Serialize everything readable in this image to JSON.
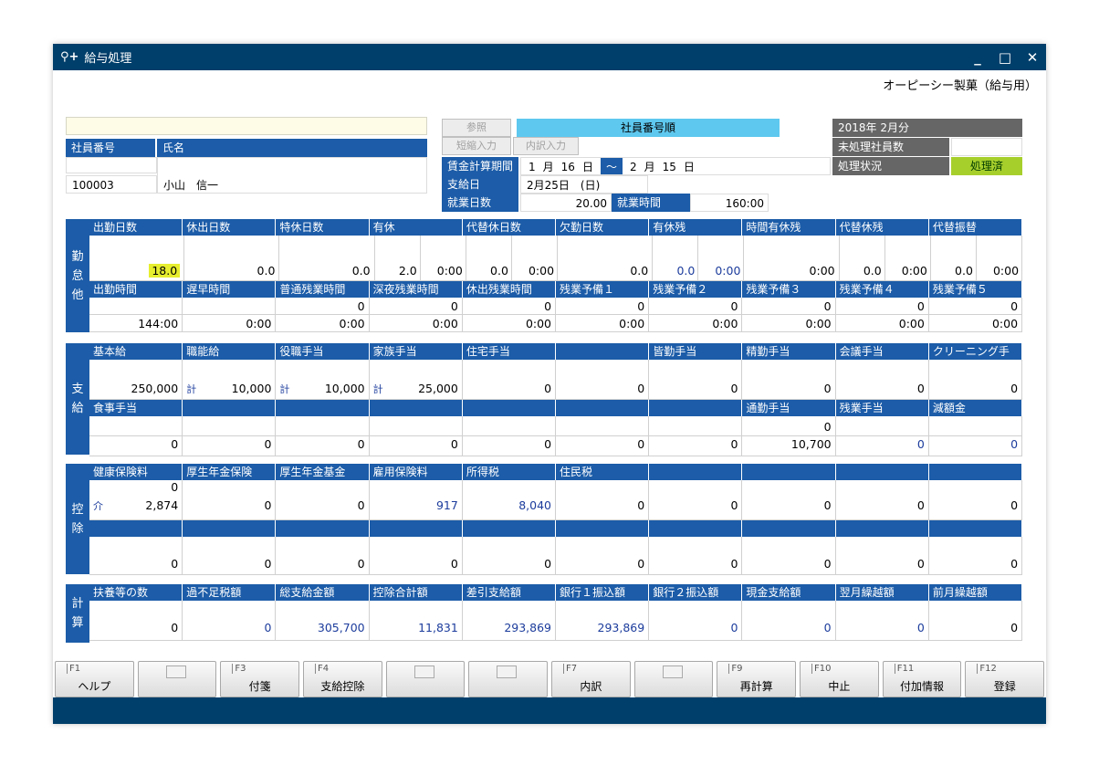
{
  "title": "給与処理",
  "title_icon": "⚲+",
  "company": "オーピーシー製菓（給与用）",
  "emp": {
    "no_label": "社員番号",
    "name_label": "氏名",
    "no": "100003",
    "name": "小山　信一"
  },
  "btns": {
    "ref": "参照",
    "short": "短縮入力",
    "detail": "内訳入力",
    "order": "社員番号順"
  },
  "period": {
    "label": "賃金計算期間",
    "m1": "1",
    "mu1": "月",
    "d1": "16",
    "du1": "日",
    "tilde": "～",
    "m2": "2",
    "mu2": "月",
    "d2": "15",
    "du2": "日",
    "pay_label": "支給日",
    "pay": "2月25日　(日)",
    "days_label": "就業日数",
    "days": "20.00",
    "hours_label": "就業時間",
    "hours": "160:00"
  },
  "status": {
    "month": "2018年 2月分",
    "unproc": "未処理社員数",
    "proc": "処理状況",
    "proc_val": "処理済"
  },
  "s1": {
    "side": [
      "勤",
      "怠",
      "他"
    ],
    "h1": [
      "出勤日数",
      "休出日数",
      "特休日数",
      "有休",
      "代替休日数",
      "欠勤日数",
      "有休残",
      "時間有休残",
      "代替休残",
      "代替振替"
    ],
    "v1": [
      "18.0",
      "0.0",
      "0.0",
      [
        "2.0",
        "0:00"
      ],
      [
        "0.0",
        "0:00"
      ],
      "0.0",
      [
        "0.0",
        "0:00"
      ],
      "0:00",
      [
        "0.0",
        "0:00"
      ],
      [
        "0.0",
        "0:00"
      ]
    ],
    "h2": [
      "出勤時間",
      "遅早時間",
      "普通残業時間",
      "深夜残業時間",
      "休出残業時間",
      "残業予備１",
      "残業予備２",
      "残業予備３",
      "残業予備４",
      "残業予備５"
    ],
    "v2a": [
      "",
      "",
      "0",
      "0",
      "0",
      "0",
      "0",
      "0",
      "0",
      "0"
    ],
    "v2b": [
      "144:00",
      "0:00",
      "0:00",
      "0:00",
      "0:00",
      "0:00",
      "0:00",
      "0:00",
      "0:00",
      "0:00"
    ]
  },
  "s2": {
    "side": [
      "支",
      "給"
    ],
    "h1": [
      "基本給",
      "職能給",
      "役職手当",
      "家族手当",
      "住宅手当",
      "",
      "皆勤手当",
      "精勤手当",
      "会議手当",
      "クリーニング手"
    ],
    "sub": [
      "",
      "計",
      "計",
      "計",
      "",
      "",
      "",
      "",
      "",
      ""
    ],
    "v1": [
      "250,000",
      "10,000",
      "10,000",
      "25,000",
      "0",
      "0",
      "0",
      "0",
      "0",
      "0"
    ],
    "h2": [
      "食事手当",
      "",
      "",
      "",
      "",
      "",
      "",
      "通勤手当",
      "残業手当",
      "減額金"
    ],
    "v2a": [
      "",
      "",
      "",
      "",
      "",
      "",
      "",
      "0",
      "",
      ""
    ],
    "v2b": [
      "0",
      "0",
      "0",
      "0",
      "0",
      "0",
      "0",
      "10,700",
      "0",
      "0"
    ]
  },
  "s3": {
    "side": [
      "控",
      "除"
    ],
    "h1": [
      "健康保険料",
      "厚生年金保険",
      "厚生年金基金",
      "雇用保険料",
      "所得税",
      "住民税",
      "",
      "",
      "",
      ""
    ],
    "sub": "介",
    "subv": "0",
    "v1": [
      "2,874",
      "0",
      "0",
      "917",
      "8,040",
      "0",
      "0",
      "0",
      "0",
      "0"
    ],
    "v2": [
      "0",
      "0",
      "0",
      "0",
      "0",
      "0",
      "0",
      "0",
      "0",
      "0"
    ]
  },
  "s4": {
    "side": [
      "計",
      "算"
    ],
    "h1": [
      "扶養等の数",
      "過不足税額",
      "総支給金額",
      "控除合計額",
      "差引支給額",
      "銀行１振込額",
      "銀行２振込額",
      "現金支給額",
      "翌月繰越額",
      "前月繰越額"
    ],
    "v1": [
      "0",
      "0",
      "305,700",
      "11,831",
      "293,869",
      "293,869",
      "0",
      "0",
      "0",
      "0"
    ]
  },
  "fkeys": [
    {
      "k": "F1",
      "l": "ヘルプ"
    },
    {
      "k": "",
      "l": ""
    },
    {
      "k": "F3",
      "l": "付箋"
    },
    {
      "k": "F4",
      "l": "支給控除"
    },
    {
      "k": "",
      "l": ""
    },
    {
      "k": "",
      "l": ""
    },
    {
      "k": "F7",
      "l": "内訳"
    },
    {
      "k": "",
      "l": ""
    },
    {
      "k": "F9",
      "l": "再計算"
    },
    {
      "k": "F10",
      "l": "中止"
    },
    {
      "k": "F11",
      "l": "付加情報"
    },
    {
      "k": "F12",
      "l": "登録"
    }
  ]
}
